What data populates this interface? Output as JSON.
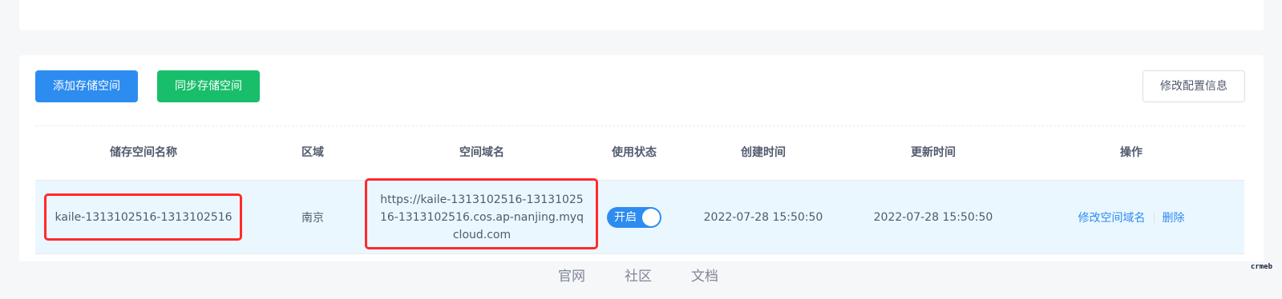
{
  "toolbar": {
    "add_label": "添加存储空间",
    "sync_label": "同步存储空间",
    "edit_config_label": "修改配置信息"
  },
  "table": {
    "columns": [
      "储存空间名称",
      "区域",
      "空间域名",
      "使用状态",
      "创建时间",
      "更新时间",
      "操作"
    ],
    "rows": [
      {
        "name": "kaile-1313102516-1313102516",
        "region": "南京",
        "domain": "https://kaile-1313102516-1313102516-1313102516.cos.ap-nanjing.myqcloud.com",
        "status_label": "开启",
        "status_on": true,
        "created": "2022-07-28 15:50:50",
        "updated": "2022-07-28 15:50:50",
        "action_edit": "修改空间域名",
        "action_delete": "删除"
      }
    ]
  },
  "footer": {
    "links": [
      "官网",
      "社区",
      "文档"
    ]
  },
  "brand": "crmeb",
  "colors": {
    "primary": "#2d8cf0",
    "success": "#19be6b",
    "highlight": "#ff2a2a",
    "row_bg": "#ebf7ff"
  }
}
